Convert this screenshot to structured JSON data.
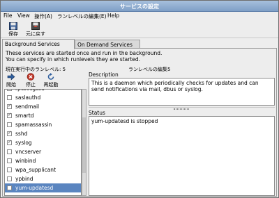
{
  "window": {
    "title": "サービスの設定"
  },
  "menu": [
    {
      "label": "File"
    },
    {
      "label": "View"
    },
    {
      "label": "操作(A)"
    },
    {
      "label": "ランレベルの編集(E)"
    },
    {
      "label": "Help"
    }
  ],
  "toolbar": {
    "save_label": "保存",
    "revert_label": "元に戻す",
    "save_icon": "floppy-icon",
    "revert_icon": "revert-icon"
  },
  "tabs": [
    {
      "label": "Background Services",
      "active": true
    },
    {
      "label": "On Demand Services",
      "active": false
    }
  ],
  "info": {
    "line1": "These services are started once and run in the background.",
    "line2": "You can specify in which runlevels they are started."
  },
  "runlevel": {
    "current": "現在実行中のランレベル: 5",
    "editing": "ランレベルの編集5"
  },
  "service_toolbar": {
    "start_label": "開始",
    "stop_label": "停止",
    "restart_label": "再起動"
  },
  "services": [
    {
      "name": "rpcsvcgssd",
      "checked": false
    },
    {
      "name": "saslauthd",
      "checked": false
    },
    {
      "name": "sendmail",
      "checked": true
    },
    {
      "name": "smartd",
      "checked": true
    },
    {
      "name": "spamassassin",
      "checked": false
    },
    {
      "name": "sshd",
      "checked": true
    },
    {
      "name": "syslog",
      "checked": true
    },
    {
      "name": "vncserver",
      "checked": false
    },
    {
      "name": "winbind",
      "checked": false
    },
    {
      "name": "wpa_supplicant",
      "checked": false
    },
    {
      "name": "ypbind",
      "checked": false
    },
    {
      "name": "yum-updatesd",
      "checked": false,
      "selected": true
    }
  ],
  "description": {
    "label": "Description",
    "text": "This is a daemon which periodically checks for updates and can send notifications via mail, dbus or syslog."
  },
  "status": {
    "label": "Status",
    "text": "yum-updatesd is stopped"
  },
  "colors": {
    "selection": "#5a85c0",
    "titlebar": "#7f9fc6",
    "stop": "#c0392b",
    "start": "#2f5f9e"
  }
}
